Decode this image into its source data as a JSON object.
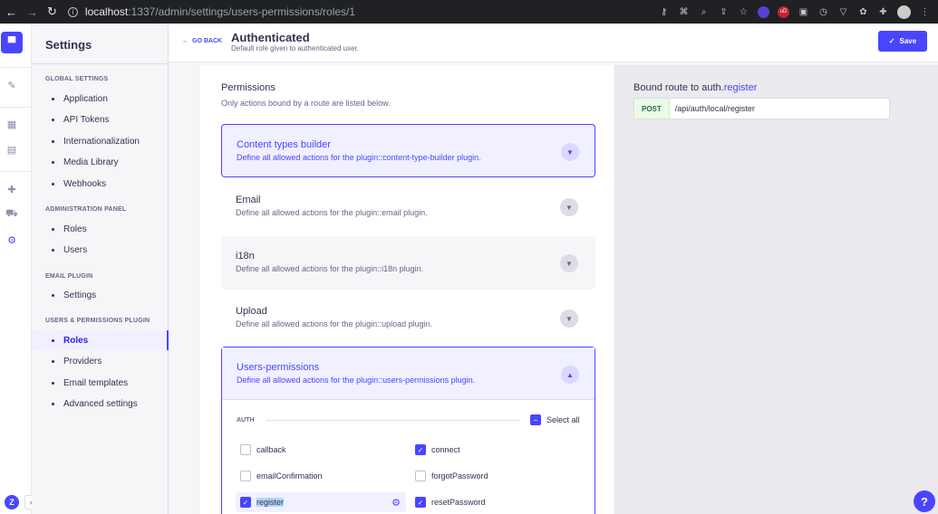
{
  "browser": {
    "url_host": "localhost",
    "url_path": ":1337/admin/settings/users-permissions/roles/1"
  },
  "sidebar": {
    "title": "Settings",
    "sections": [
      {
        "label": "GLOBAL SETTINGS",
        "items": [
          "Application",
          "API Tokens",
          "Internationalization",
          "Media Library",
          "Webhooks"
        ]
      },
      {
        "label": "ADMINISTRATION PANEL",
        "items": [
          "Roles",
          "Users"
        ]
      },
      {
        "label": "EMAIL PLUGIN",
        "items": [
          "Settings"
        ]
      },
      {
        "label": "USERS & PERMISSIONS PLUGIN",
        "items": [
          "Roles",
          "Providers",
          "Email templates",
          "Advanced settings"
        ]
      }
    ],
    "active_item": "Roles"
  },
  "header": {
    "back_label": "GO BACK",
    "title": "Authenticated",
    "subtitle": "Default role given to authenticated user.",
    "save_label": "Save"
  },
  "permissions": {
    "title": "Permissions",
    "description": "Only actions bound by a route are listed below.",
    "plugins": [
      {
        "name": "Content types builder",
        "description": "Define all allowed actions for the plugin::content-type-builder plugin."
      },
      {
        "name": "Email",
        "description": "Define all allowed actions for the plugin::email plugin."
      },
      {
        "name": "i18n",
        "description": "Define all allowed actions for the plugin::i18n plugin."
      },
      {
        "name": "Upload",
        "description": "Define all allowed actions for the plugin::upload plugin."
      },
      {
        "name": "Users-permissions",
        "description": "Define all allowed actions for the plugin::users-permissions plugin."
      }
    ],
    "group_label": "AUTH",
    "select_all_label": "Select all",
    "actions": [
      {
        "label": "callback",
        "checked": false
      },
      {
        "label": "connect",
        "checked": true
      },
      {
        "label": "emailConfirmation",
        "checked": false
      },
      {
        "label": "forgotPassword",
        "checked": false
      },
      {
        "label": "register",
        "checked": true
      },
      {
        "label": "resetPassword",
        "checked": true
      }
    ]
  },
  "route": {
    "title_prefix": "Bound route to ",
    "title_controller": "auth.",
    "title_action": "register",
    "method": "POST",
    "path": "/api/auth/local/register"
  },
  "rail": {
    "user_initial": "Z"
  },
  "help_label": "?"
}
